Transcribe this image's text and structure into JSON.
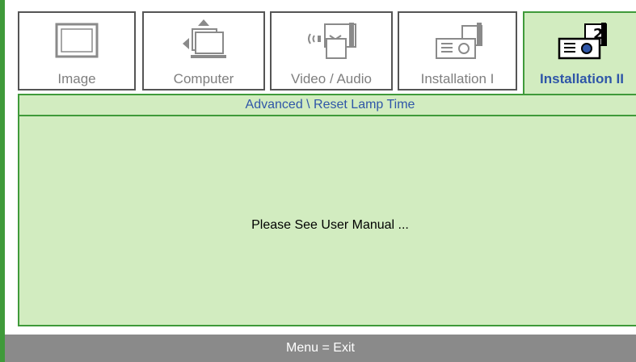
{
  "tabs": [
    {
      "label": "Image",
      "icon": "image-icon",
      "active": false
    },
    {
      "label": "Computer",
      "icon": "computer-icon",
      "active": false
    },
    {
      "label": "Video / Audio",
      "icon": "video-audio-icon",
      "active": false
    },
    {
      "label": "Installation I",
      "icon": "projector-installation-1-icon",
      "active": false
    },
    {
      "label": "Installation II",
      "icon": "projector-installation-2-icon",
      "active": true
    }
  ],
  "breadcrumb": "Advanced \\ Reset Lamp Time",
  "message": "Please See User Manual ...",
  "footer": "Menu = Exit",
  "colors": {
    "accent_green": "#3f9a3a",
    "panel_green": "#d2ecc0",
    "active_label_blue": "#2f56a8",
    "inactive_label_gray": "#7f7f7f",
    "footer_gray": "#8a8a8a"
  }
}
